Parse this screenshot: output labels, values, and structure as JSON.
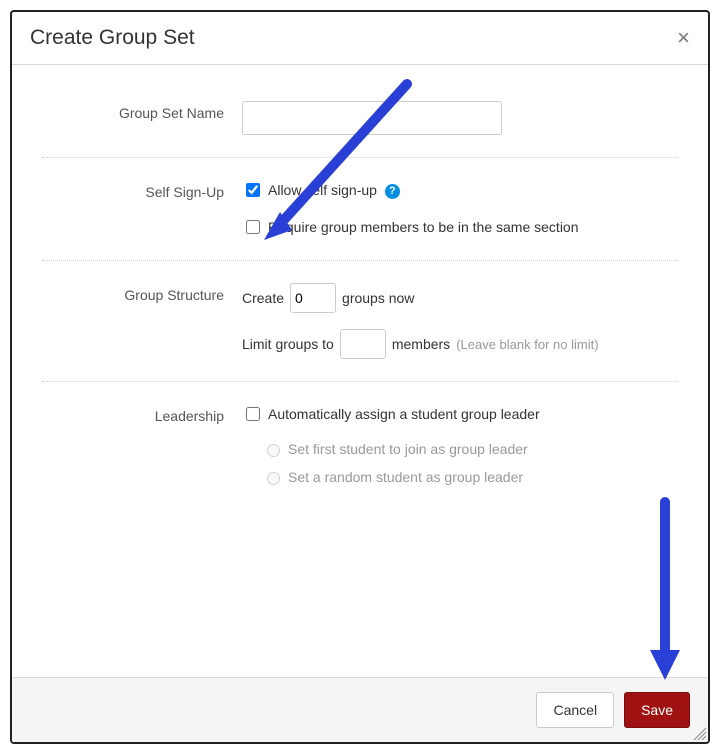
{
  "dialog": {
    "title": "Create Group Set",
    "close_label": "×"
  },
  "group_name": {
    "label": "Group Set Name",
    "value": "",
    "placeholder": ""
  },
  "self_signup": {
    "label": "Self Sign-Up",
    "allow_label": "Allow self sign-up",
    "allow_checked": true,
    "help_icon": "?",
    "same_section_label": "Require group members to be in the same section",
    "same_section_checked": false
  },
  "structure": {
    "label": "Group Structure",
    "create_prefix": "Create",
    "create_count": "0",
    "create_suffix": "groups now",
    "limit_prefix": "Limit groups to",
    "limit_value": "",
    "limit_suffix": "members",
    "limit_hint": "(Leave blank for no limit)"
  },
  "leadership": {
    "label": "Leadership",
    "auto_assign_label": "Automatically assign a student group leader",
    "auto_assign_checked": false,
    "radio_first_label": "Set first student to join as group leader",
    "radio_random_label": "Set a random student as group leader"
  },
  "footer": {
    "cancel": "Cancel",
    "save": "Save"
  }
}
